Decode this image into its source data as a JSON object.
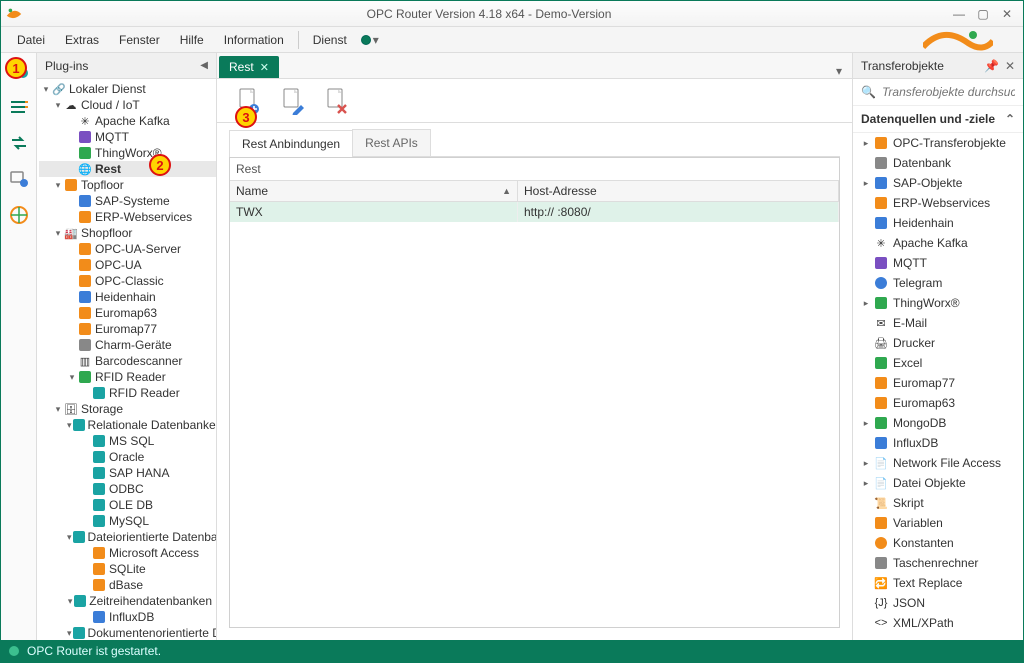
{
  "window": {
    "title": "OPC Router Version 4.18 x64 - Demo-Version"
  },
  "menu": {
    "datei": "Datei",
    "extras": "Extras",
    "fenster": "Fenster",
    "hilfe": "Hilfe",
    "information": "Information",
    "dienst": "Dienst"
  },
  "plugins": {
    "title": "Plug-ins",
    "tree": {
      "root": "Lokaler Dienst",
      "cloud": "Cloud / IoT",
      "kafka": "Apache Kafka",
      "mqtt": "MQTT",
      "thingworx": "ThingWorx®",
      "rest": "Rest",
      "topfloor": "Topfloor",
      "sap": "SAP-Systeme",
      "erp": "ERP-Webservices",
      "shopfloor": "Shopfloor",
      "opcua_srv": "OPC-UA-Server",
      "opcua": "OPC-UA",
      "opcclassic": "OPC-Classic",
      "heidenhain": "Heidenhain",
      "euromap63": "Euromap63",
      "euromap77": "Euromap77",
      "charm": "Charm-Geräte",
      "barcode": "Barcodescanner",
      "rfid_grp": "RFID Reader",
      "rfid": "RFID Reader",
      "storage": "Storage",
      "reldb": "Relationale Datenbanken",
      "mssql": "MS SQL",
      "oracle": "Oracle",
      "saphana": "SAP HANA",
      "odbc": "ODBC",
      "oledb": "OLE DB",
      "mysql": "MySQL",
      "filedb": "Dateiorientierte Datenban...",
      "access": "Microsoft Access",
      "sqlite": "SQLite",
      "dbase": "dBase",
      "tsdb": "Zeitreihendatenbanken",
      "influx": "InfluxDB",
      "docdb": "Dokumentenorientierte Da..."
    }
  },
  "center": {
    "tab": "Rest",
    "subtabs": {
      "conn": "Rest Anbindungen",
      "apis": "Rest APIs"
    },
    "grid_title": "Rest",
    "cols": {
      "name": "Name",
      "addr": "Host-Adresse"
    },
    "row": {
      "name": "TWX",
      "addr": "http://          :8080/"
    },
    "sort_glyph": "▲"
  },
  "right": {
    "title": "Transferobjekte",
    "search_ph": "Transferobjekte durchsuchen",
    "section": "Datenquellen und -ziele",
    "items": {
      "opctrans": "OPC-Transferobjekte",
      "db": "Datenbank",
      "sap": "SAP-Objekte",
      "erp": "ERP-Webservices",
      "heidenhain": "Heidenhain",
      "kafka": "Apache Kafka",
      "mqtt": "MQTT",
      "telegram": "Telegram",
      "thingworx": "ThingWorx®",
      "email": "E-Mail",
      "printer": "Drucker",
      "excel": "Excel",
      "euromap77": "Euromap77",
      "euromap63": "Euromap63",
      "mongo": "MongoDB",
      "influx": "InfluxDB",
      "nfa": "Network File Access",
      "fileobj": "Datei Objekte",
      "script": "Skript",
      "vars": "Variablen",
      "const": "Konstanten",
      "calc": "Taschenrechner",
      "replace": "Text Replace",
      "json": "JSON",
      "xml": "XML/XPath"
    }
  },
  "status": {
    "text": "OPC Router ist gestartet."
  },
  "annos": {
    "a1": "1",
    "a2": "2",
    "a3": "3"
  },
  "glyph": {
    "tri_right": "▸",
    "tri_down": "▾",
    "chev_up": "⌃",
    "close": "✕"
  }
}
